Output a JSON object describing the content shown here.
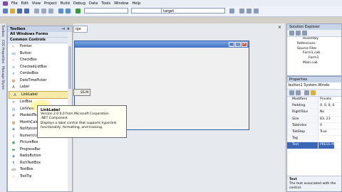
{
  "menu": [
    "File",
    "Edit",
    "View",
    "Project",
    "Build",
    "Debug",
    "Data",
    "Tools",
    "Window",
    "Help"
  ],
  "toolbar": {
    "target_combo": "target"
  },
  "left_tabs": [
    "Toolbox",
    "CSS Properties",
    "Manage Styles"
  ],
  "toolbox": {
    "title": "Toolbox",
    "sections": [
      "All Windows Forms",
      "Common Controls"
    ],
    "items": [
      {
        "label": "Pointer",
        "icon": "pointer-icon",
        "glyph": "↖",
        "color": "#5b7fbf"
      },
      {
        "label": "Button",
        "icon": "button-control-icon",
        "glyph": "ab",
        "color": "#6a8fcf"
      },
      {
        "label": "CheckBox",
        "icon": "checkbox-control-icon",
        "glyph": "✓",
        "color": "#6aa05a"
      },
      {
        "label": "CheckedListBox",
        "icon": "checkedlistbox-icon",
        "glyph": "≡",
        "color": "#5a8ac8"
      },
      {
        "label": "ComboBox",
        "icon": "combobox-icon",
        "glyph": "▾",
        "color": "#5a8ac8"
      },
      {
        "label": "DateTimePicker",
        "icon": "datetimepicker-icon",
        "glyph": "▦",
        "color": "#c87a3a"
      },
      {
        "label": "Label",
        "icon": "label-control-icon",
        "glyph": "A",
        "color": "#444444"
      },
      {
        "label": "LinkLabel",
        "icon": "linklabel-icon",
        "glyph": "A",
        "color": "#2a56c0"
      },
      {
        "label": "ListBox",
        "icon": "listbox-icon",
        "glyph": "≡",
        "color": "#5a8ac8"
      },
      {
        "label": "ListView",
        "icon": "listview-icon",
        "glyph": "▤",
        "color": "#5a8ac8"
      },
      {
        "label": "MaskedTextBox",
        "icon": "maskedtextbox-icon",
        "glyph": "#",
        "color": "#7a7a7a"
      },
      {
        "label": "MonthCalendar",
        "icon": "monthcalendar-icon",
        "glyph": "▦",
        "color": "#c87a3a"
      },
      {
        "label": "NotifyIcon",
        "icon": "notifyicon-icon",
        "glyph": "◉",
        "color": "#5a8ac8"
      },
      {
        "label": "NumericUpDown",
        "icon": "numericupdown-icon",
        "glyph": "↕",
        "color": "#5a8ac8"
      },
      {
        "label": "PictureBox",
        "icon": "picturebox-icon",
        "glyph": "▣",
        "color": "#3a9a5a"
      },
      {
        "label": "ProgressBar",
        "icon": "progressbar-icon",
        "glyph": "▬",
        "color": "#3a9a5a"
      },
      {
        "label": "RadioButton",
        "icon": "radiobutton-icon",
        "glyph": "◉",
        "color": "#5a8ac8"
      },
      {
        "label": "RichTextBox",
        "icon": "richtextbox-icon",
        "glyph": "¶",
        "color": "#5a8ac8"
      },
      {
        "label": "TextBox",
        "icon": "textbox-icon",
        "glyph": "ab",
        "color": "#7a7a7a"
      },
      {
        "label": "ToolTip",
        "icon": "tooltip-control-icon",
        "glyph": "▭",
        "color": "#d0b040"
      }
    ]
  },
  "designer": {
    "tab_label": "ige",
    "form_button_text": "SS M"
  },
  "tooltip": {
    "title": "LinkLabel",
    "line1": "Version 2.0.0.0 from Microsoft Corporation",
    "line2": ".NET Component",
    "line3": "Displays a label control that supports hyperlink",
    "line4": "functionality, formatting, and tracking."
  },
  "solution_explorer": {
    "title": "Solution Explorer",
    "items": [
      "Assembly",
      "References",
      "Source Files",
      "Form1.cob",
      "Form1",
      "Main.cob"
    ]
  },
  "properties": {
    "title": "Properties",
    "object": "button1  System.Windo",
    "rows": [
      {
        "name": "Modifiers",
        "value": "Private"
      },
      {
        "name": "Padding",
        "value": "0, 0, 0, 0"
      },
      {
        "name": "RightToLe",
        "value": "No"
      },
      {
        "name": "Size",
        "value": "83, 23"
      },
      {
        "name": "TabIndex",
        "value": "0"
      },
      {
        "name": "TabStop",
        "value": "True"
      },
      {
        "name": "Tag",
        "value": ""
      },
      {
        "name": "Text",
        "value": "PRESS M"
      }
    ],
    "desc_title": "Text",
    "desc_text": "The text associated with the control."
  }
}
